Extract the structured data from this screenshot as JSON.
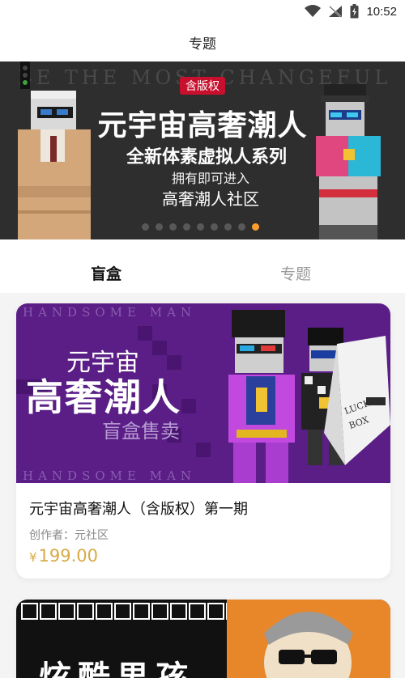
{
  "status_bar": {
    "time": "10:52"
  },
  "header": {
    "title": "专题"
  },
  "banner": {
    "bg_text": "BE THE MOST CHANGEFUL",
    "badge": "含版权",
    "title": "元宇宙高奢潮人",
    "subtitle": "全新体素虚拟人系列",
    "line2": "拥有即可进入",
    "line3": "高奢潮人社区"
  },
  "tabs": [
    {
      "label": "盲盒",
      "active": true
    },
    {
      "label": "专题",
      "active": false
    }
  ],
  "cards": [
    {
      "image": {
        "watermark": "HANDSOME  MAN",
        "line1": "元宇宙",
        "line2": "高奢潮人",
        "line3": "盲盒售卖",
        "box_text": "LUCKY BOX"
      },
      "title": "元宇宙高奢潮人（含版权）第一期",
      "author": "创作者：元社区",
      "currency": "¥",
      "price": "199.00"
    },
    {
      "image": {
        "text": "炫酷男孩"
      }
    }
  ],
  "colors": {
    "accent": "#ff9e2c",
    "price": "#d8aa45",
    "badge": "#c8102e",
    "card_purple": "#5a1e86"
  },
  "icons": [
    "wifi-icon",
    "signal-icon",
    "battery-icon"
  ]
}
